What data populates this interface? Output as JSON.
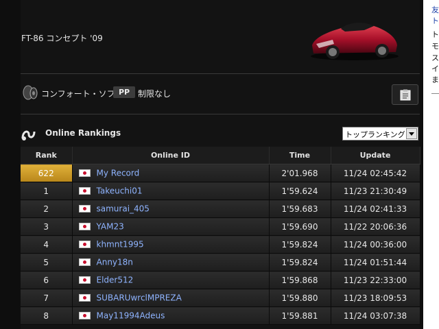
{
  "car": {
    "name": "FT-86 コンセプト '09",
    "image_icon": "red-sports-car"
  },
  "settings": {
    "tyre_icon": "tyre-icon",
    "tyre_label": "コンフォート・ソフト",
    "pp_badge": "PP",
    "pp_value": "制限なし",
    "memo_icon": "clipboard-icon"
  },
  "rankings": {
    "title": "Online Rankings",
    "icon": "online-rankings-icon",
    "filter_selected": "トップランキング",
    "columns": [
      "Rank",
      "Online ID",
      "Time",
      "Update"
    ],
    "rows": [
      {
        "rank": "622",
        "id": "My Record",
        "time": "2'01.968",
        "update": "11/24 02:45:42",
        "mine": true
      },
      {
        "rank": "1",
        "id": "Takeuchi01",
        "time": "1'59.624",
        "update": "11/23 21:30:49"
      },
      {
        "rank": "2",
        "id": "samurai_405",
        "time": "1'59.683",
        "update": "11/24 02:41:33"
      },
      {
        "rank": "3",
        "id": "YAM23",
        "time": "1'59.690",
        "update": "11/22 20:06:36"
      },
      {
        "rank": "4",
        "id": "khmnt1995",
        "time": "1'59.824",
        "update": "11/24 00:36:00"
      },
      {
        "rank": "5",
        "id": "Anny18n",
        "time": "1'59.824",
        "update": "11/24 01:51:44"
      },
      {
        "rank": "6",
        "id": "Elder512",
        "time": "1'59.868",
        "update": "11/23 22:33:00"
      },
      {
        "rank": "7",
        "id": "SUBARUwrclMPREZA",
        "time": "1'59.880",
        "update": "11/23 18:09:53"
      },
      {
        "rank": "8",
        "id": "May11994Adeus",
        "time": "1'59.881",
        "update": "11/24 03:07:38"
      }
    ]
  },
  "sidebar": {
    "lines": [
      "友",
      "ト",
      "ト",
      "モ",
      "ス",
      "イ",
      "ま"
    ]
  },
  "colors": {
    "background": "#0e0e0e",
    "my_record_rank": "#d4a12a",
    "link": "#8fb4ff"
  }
}
